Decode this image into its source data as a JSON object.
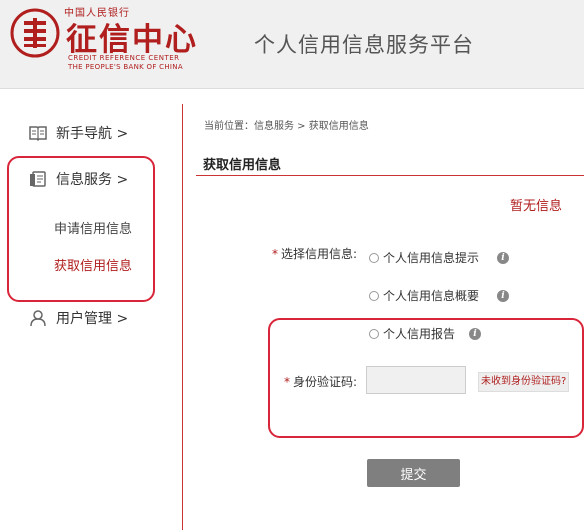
{
  "header": {
    "logo_top": "中国人民银行",
    "logo_main": "征信中心",
    "logo_en_line1": "CREDIT REFERENCE CENTER",
    "logo_en_line2": "THE PEOPLE'S BANK OF CHINA",
    "platform_title": "个人信用信息服务平台"
  },
  "sidebar": {
    "items": [
      {
        "label": "新手导航 >",
        "icon": "book-icon"
      },
      {
        "label": "信息服务 >",
        "icon": "document-icon"
      },
      {
        "label": "用户管理 >",
        "icon": "user-icon"
      }
    ],
    "sub_items": [
      {
        "label": "申请信用信息",
        "active": false
      },
      {
        "label": "获取信用信息",
        "active": true
      }
    ]
  },
  "main": {
    "breadcrumb": "当前位置：信息服务 > 获取信用信息",
    "section_title": "获取信用信息",
    "no_info": "暂无信息",
    "select_label": "选择信用信息:",
    "required_mark": "*",
    "options": [
      {
        "label": "个人信用信息提示",
        "info_icon": "info-icon",
        "checked": false
      },
      {
        "label": "个人信用信息概要",
        "info_icon": "info-icon",
        "checked": false
      },
      {
        "label": "个人信用报告",
        "info_icon": "info-icon",
        "checked": false
      }
    ],
    "code_label": "身份验证码:",
    "code_value": "",
    "code_link": "未收到身份验证码?",
    "submit_label": "提交"
  },
  "colors": {
    "brand_red": "#b01e1e",
    "callout_red": "#d9253a",
    "button_gray": "#7f7f7f",
    "header_bg": "#f0f0f0"
  }
}
